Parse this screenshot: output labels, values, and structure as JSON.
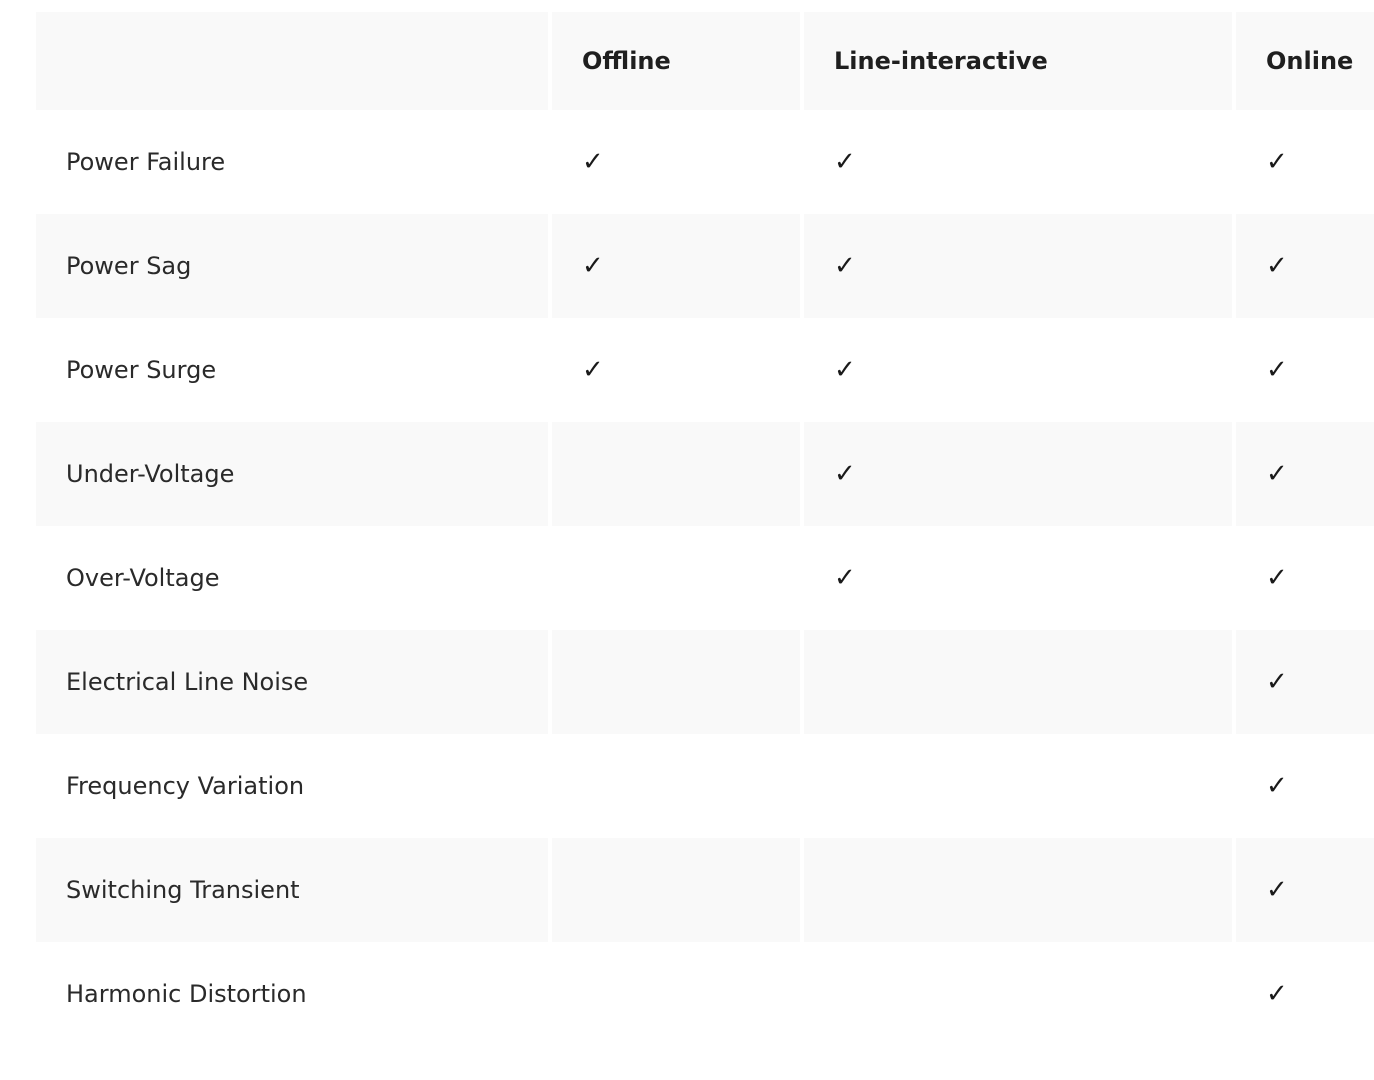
{
  "table": {
    "columns": [
      "",
      "Offline",
      "Line-interactive",
      "Online"
    ],
    "check_glyph": "✓",
    "rows": [
      {
        "label": "Power Failure",
        "offline": true,
        "line_interactive": true,
        "online": true
      },
      {
        "label": "Power Sag",
        "offline": true,
        "line_interactive": true,
        "online": true
      },
      {
        "label": "Power Surge",
        "offline": true,
        "line_interactive": true,
        "online": true
      },
      {
        "label": "Under-Voltage",
        "offline": false,
        "line_interactive": true,
        "online": true
      },
      {
        "label": "Over-Voltage",
        "offline": false,
        "line_interactive": true,
        "online": true
      },
      {
        "label": "Electrical Line Noise",
        "offline": false,
        "line_interactive": false,
        "online": true
      },
      {
        "label": "Frequency Variation",
        "offline": false,
        "line_interactive": false,
        "online": true
      },
      {
        "label": "Switching Transient",
        "offline": false,
        "line_interactive": false,
        "online": true
      },
      {
        "label": "Harmonic Distortion",
        "offline": false,
        "line_interactive": false,
        "online": true
      }
    ]
  }
}
